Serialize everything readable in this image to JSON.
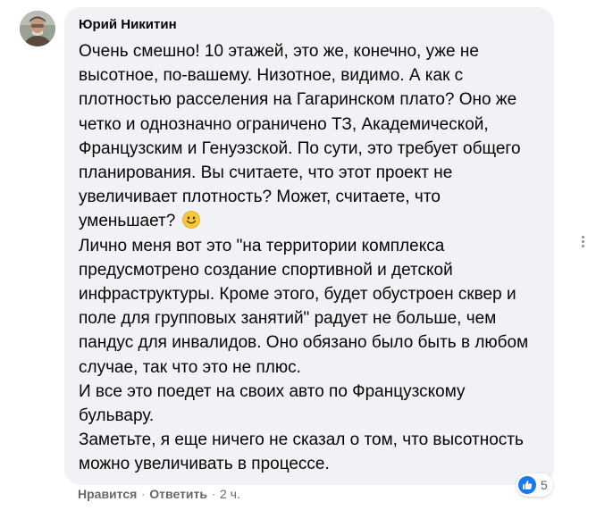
{
  "comment": {
    "author": "Юрий Никитин",
    "paragraphs": [
      "Очень смешно! 10 этажей, это же, конечно, уже не высотное, по-вашему. Низотное, видимо. А как с плотностью расселения на Гагаринском плато? Оно же четко и однозначно ограничено ТЗ, Академической, Французским и Генуэзской. По сути, это требует общего планирования. Вы считаете, что этот проект не увеличивает плотность? Может, считаете, что уменьшает?",
      "Лично меня вот это \"на территории комплекса предусмотрено создание спортивной и детской инфраструктуры. Кроме этого, будет обустроен сквер и поле для групповых занятий\" радует не больше, чем пандус для инвалидов. Оно обязано было быть в любом случае, так что это не плюс.",
      "И все это поедет на своих авто по Французскому бульвару.",
      "Заметьте, я еще ничего не сказал о том, что высотность можно увеличивать в процессе."
    ],
    "emoji": "slightly-smiling-face-icon"
  },
  "actions": {
    "like_label": "Нравится",
    "reply_label": "Ответить",
    "separator": "·",
    "time": "2 ч."
  },
  "reactions": {
    "icon": "thumbs-up-icon",
    "count": "5",
    "color": "#1877f2"
  },
  "colors": {
    "bubble": "#f0f2f5",
    "text": "#050505",
    "muted": "#65676b"
  }
}
